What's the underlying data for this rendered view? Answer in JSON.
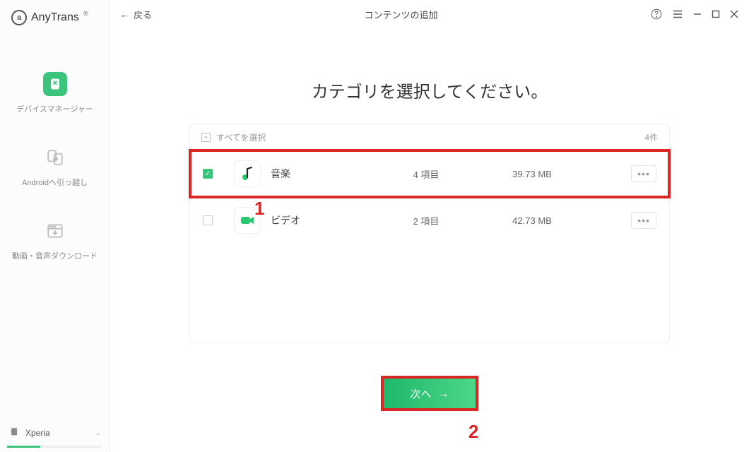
{
  "app_name": "AnyTrans",
  "sidebar": {
    "items": [
      {
        "label": "デバイスマネージャー"
      },
      {
        "label": "Androidへ引っ越し"
      },
      {
        "label": "動画・音声ダウンロード"
      }
    ]
  },
  "device": {
    "name": "Xperia"
  },
  "header": {
    "back_label": "戻る",
    "title": "コンテンツの追加"
  },
  "heading": "カテゴリを選択してください。",
  "panel": {
    "select_all_label": "すべてを選択",
    "count_label": "4件"
  },
  "categories": [
    {
      "name": "音楽",
      "items": "4 項目",
      "size": "39.73 MB",
      "checked": true
    },
    {
      "name": "ビデオ",
      "items": "2 項目",
      "size": "42.73 MB",
      "checked": false
    }
  ],
  "next_label": "次へ",
  "callouts": {
    "one": "1",
    "two": "2"
  }
}
